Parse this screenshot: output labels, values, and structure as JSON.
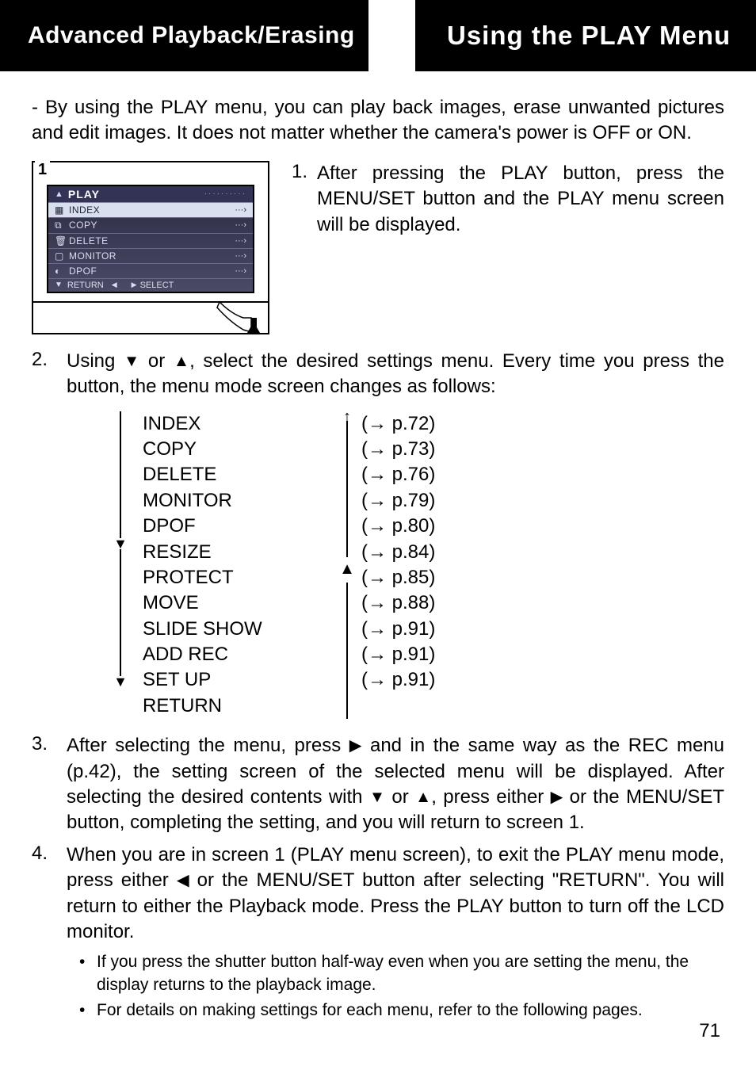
{
  "header": {
    "left": "Advanced Playback/Erasing",
    "right": "Using the PLAY Menu"
  },
  "intro": "- By using the PLAY menu, you can play back images, erase unwanted pictures and edit images. It does not matter whether the camera's power is OFF or ON.",
  "lcd": {
    "frame_label": "1",
    "title": "PLAY",
    "rows": [
      {
        "label": "INDEX",
        "selected": true
      },
      {
        "label": "COPY",
        "selected": false
      },
      {
        "label": "DELETE",
        "selected": false
      },
      {
        "label": "MONITOR",
        "selected": false
      },
      {
        "label": "DPOF",
        "selected": false
      }
    ],
    "footer_return": "RETURN",
    "footer_select": "SELECT"
  },
  "step1": {
    "num": "1.",
    "text": "After pressing the PLAY button, press the MENU/SET button and the PLAY menu screen will be displayed."
  },
  "step2": {
    "num": "2.",
    "text_before": "Using ",
    "text_mid": " or ",
    "text_after": ", select the desired settings menu. Every time you press the button, the menu mode screen changes as follows:"
  },
  "menu_items": [
    {
      "name": "INDEX",
      "ref": "(→ p.72)"
    },
    {
      "name": "COPY",
      "ref": "(→ p.73)"
    },
    {
      "name": "DELETE",
      "ref": "(→ p.76)"
    },
    {
      "name": "MONITOR",
      "ref": "(→ p.79)"
    },
    {
      "name": "DPOF",
      "ref": "(→ p.80)"
    },
    {
      "name": "RESIZE",
      "ref": "(→ p.84)"
    },
    {
      "name": "PROTECT",
      "ref": "(→ p.85)"
    },
    {
      "name": "MOVE",
      "ref": "(→ p.88)"
    },
    {
      "name": "SLIDE SHOW",
      "ref": "(→ p.91)"
    },
    {
      "name": "ADD REC",
      "ref": "(→ p.91)"
    },
    {
      "name": "SET UP",
      "ref": "(→ p.91)"
    },
    {
      "name": "RETURN",
      "ref": ""
    }
  ],
  "step3": {
    "num": "3.",
    "p1": "After selecting the menu, press ",
    "p2": " and in the same way as the REC menu (p.42), the setting screen of the selected menu will be displayed.  After selecting the desired contents with ",
    "p3": " or ",
    "p4": ", press either ",
    "p5": " or the MENU/SET button, completing the setting, and you will return to screen 1."
  },
  "step4": {
    "num": "4.",
    "p1": "When you are in screen 1 (PLAY menu screen), to exit the PLAY menu mode, press either ",
    "p2": " or the MENU/SET button after selecting \"RETURN\". You will return to either the Playback mode.  Press the PLAY button to turn off the LCD monitor."
  },
  "bullets": [
    "If you press the shutter button half-way even when you are setting the menu, the display returns to the playback image.",
    "For details on making settings for each menu, refer to the following pages."
  ],
  "page_number": "71"
}
